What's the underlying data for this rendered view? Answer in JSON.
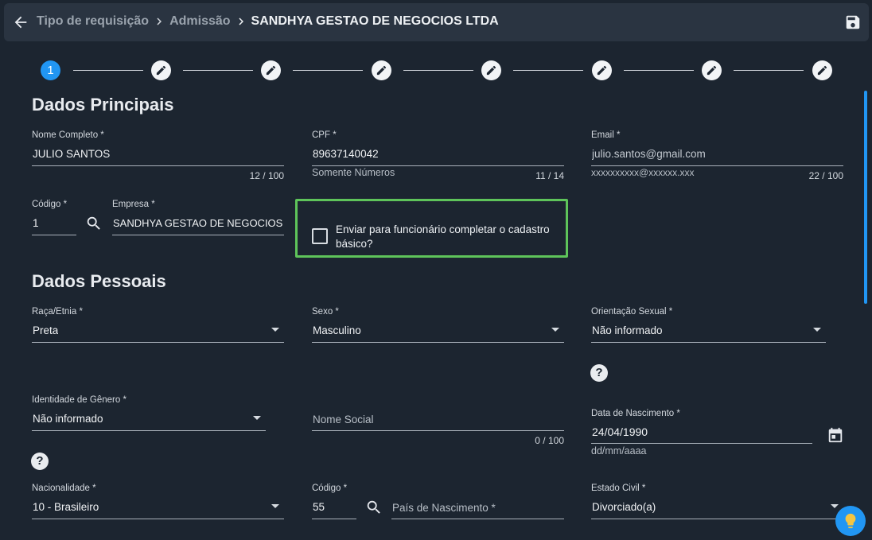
{
  "breadcrumb": {
    "items": [
      "Tipo de requisição",
      "Admissão",
      "SANDHYA GESTAO DE NEGOCIOS LTDA"
    ]
  },
  "stepper": {
    "active_step": "1",
    "total_steps": 8
  },
  "principal": {
    "title": "Dados Principais",
    "nome": {
      "label": "Nome Completo *",
      "value": "JULIO SANTOS",
      "counter": "12 / 100"
    },
    "cpf": {
      "label": "CPF *",
      "value": "89637140042",
      "hint": "Somente Números",
      "counter": "11 / 14"
    },
    "email": {
      "label": "Email *",
      "value": "julio.santos@gmail.com",
      "hint": "xxxxxxxxxx@xxxxxx.xxx",
      "counter": "22 / 100"
    },
    "codigo": {
      "label": "Código *",
      "value": "1"
    },
    "empresa": {
      "label": "Empresa *",
      "value": "SANDHYA GESTAO DE NEGOCIOS LTDA"
    },
    "enviar_checkbox": {
      "label": "Enviar para funcionário completar o cadastro básico?",
      "checked": false
    }
  },
  "pessoais": {
    "title": "Dados Pessoais",
    "raca": {
      "label": "Raça/Etnia *",
      "value": "Preta"
    },
    "sexo": {
      "label": "Sexo *",
      "value": "Masculino"
    },
    "orientacao": {
      "label": "Orientação Sexual *",
      "value": "Não informado"
    },
    "identidade": {
      "label": "Identidade de Gênero *",
      "value": "Não informado"
    },
    "nome_social": {
      "placeholder": "Nome Social",
      "counter": "0 / 100"
    },
    "nascimento": {
      "label": "Data de Nascimento *",
      "value": "24/04/1990",
      "hint": "dd/mm/aaaa"
    },
    "nacionalidade": {
      "label": "Nacionalidade *",
      "value": "10 - Brasileiro"
    },
    "codigo_pais": {
      "label": "Código *",
      "value": "55"
    },
    "pais_nascimento": {
      "placeholder": "País de Nascimento *"
    },
    "estado_civil": {
      "label": "Estado Civil *",
      "value": "Divorciado(a)"
    }
  },
  "icons": {
    "back": "arrow-left-icon",
    "save": "floppy-disk-icon",
    "search": "search-icon",
    "calendar": "calendar-icon",
    "help": "question-icon",
    "edit": "pencil-icon",
    "fab": "lightbulb-icon"
  },
  "colors": {
    "background": "#1c2530",
    "accent": "#2196f3",
    "highlight_border": "#5ec45a",
    "topbar": "#2a3441"
  }
}
